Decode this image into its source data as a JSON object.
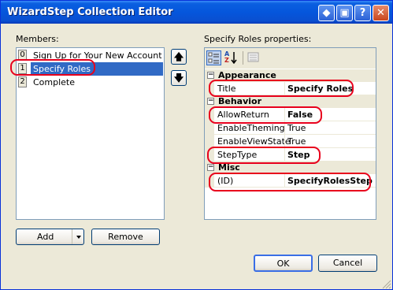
{
  "window": {
    "title": "WizardStep Collection Editor",
    "accent_color": "#0a5fe0",
    "highlight_color": "#e8001c",
    "title_buttons": [
      {
        "name": "restore-icon",
        "glyph": "◆"
      },
      {
        "name": "maximize-icon",
        "glyph": "▣"
      },
      {
        "name": "help-icon",
        "glyph": "?"
      },
      {
        "name": "close-icon",
        "glyph": "✕"
      }
    ]
  },
  "members": {
    "label": "Members:",
    "items": [
      {
        "index": "0",
        "label": "Sign Up for Your New Account",
        "selected": false
      },
      {
        "index": "1",
        "label": "Specify Roles",
        "selected": true
      },
      {
        "index": "2",
        "label": "Complete",
        "selected": false
      }
    ],
    "move_up_glyph": "🡅",
    "move_down_glyph": "🡇",
    "add_label": "Add",
    "remove_label": "Remove"
  },
  "properties": {
    "label": "Specify Roles properties:",
    "toolbar": {
      "categorized_icon": "categorized-icon",
      "alphabetical_icon": "alphabetical-icon",
      "alphabetical_text": "A",
      "alphabetical_text2": "Z",
      "property_pages_icon": "property-pages-icon"
    },
    "categories": [
      {
        "name": "Appearance",
        "rows": [
          {
            "name": "Title",
            "value": "Specify Roles",
            "bold": true
          }
        ]
      },
      {
        "name": "Behavior",
        "rows": [
          {
            "name": "AllowReturn",
            "value": "False",
            "bold": true
          },
          {
            "name": "EnableTheming",
            "value": "True",
            "bold": false
          },
          {
            "name": "EnableViewState",
            "value": "True",
            "bold": false
          },
          {
            "name": "StepType",
            "value": "Step",
            "bold": true
          }
        ]
      },
      {
        "name": "Misc",
        "rows": [
          {
            "name": "(ID)",
            "value": "SpecifyRolesStep",
            "bold": true
          }
        ]
      }
    ],
    "collapse_glyph": "−"
  },
  "footer": {
    "ok_label": "OK",
    "cancel_label": "Cancel"
  }
}
